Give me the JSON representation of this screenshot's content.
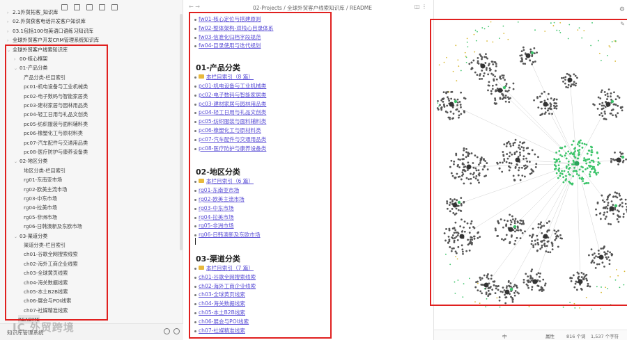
{
  "sidebar": {
    "top_rows": [
      {
        "label": "2.1外贸拓客_知识库",
        "indent": 0,
        "folder": true
      },
      {
        "label": "02.外贸获客电话开发客户知识库",
        "indent": 0,
        "folder": true
      },
      {
        "label": "03.1包括100句英语口语练习知识库",
        "indent": 0,
        "folder": true
      },
      {
        "label": "全球外贸客户开发CRM管理系统知识库",
        "indent": 0,
        "folder": true
      }
    ],
    "root": {
      "label": "全球外贸客户线索知识库"
    },
    "groups": [
      {
        "label": "00-核心框架",
        "children": []
      },
      {
        "label": "01-产品分类",
        "children": [
          "产品分类-栏目索引",
          "pc01-机电设备与工业机械类",
          "pc02-电子数码与智能家居类",
          "pc03-建材家居与园林用品类",
          "pc04-轻工日用与礼品文创类",
          "pc05-纺织服装与面料辅料类",
          "pc06-橡塑化工与原材料类",
          "pc07-汽车配件与交通用品类",
          "pc08-医疗防护与康养设备类"
        ]
      },
      {
        "label": "02-地区分类",
        "children": [
          "地区分类-栏目索引",
          "rg01-东南亚市场",
          "rg02-欧美主流市场",
          "rg03-中东市场",
          "rg04-拉美市场",
          "rg05-非洲市场",
          "rg06-日韩澳新及东欧市场"
        ]
      },
      {
        "label": "03-渠道分类",
        "children": [
          "渠道分类-栏目索引",
          "ch01-谷歌全网搜索线索",
          "ch02-海外工商企业线索",
          "ch03-全球黄页线索",
          "ch04-海关数据线索",
          "ch05-本土B2B线索",
          "ch06-展会与POI线索",
          "ch07-社媒精准线索"
        ]
      }
    ],
    "readme": "README",
    "partial_row": "... 网站 ... 家具家居 ... 小图释",
    "bottom_label": "知识库管理系统",
    "watermark": "IC 外贸跨境"
  },
  "editor": {
    "breadcrumb": "02-Projects / 全球外贸客户线索知识库 / README",
    "nav": "← →",
    "actions": "◫ ⋮",
    "top_links": [
      "fw01-核心定位与搭建原则",
      "fw02-整体架构-双栈心目录体系",
      "fw03-信准化归档字段规范",
      "fw04-目录使用与迭代规划"
    ],
    "sections": [
      {
        "title": "01-产品分类",
        "index": "本栏目索引（8 篇）",
        "links": [
          "pc01-机电设备与工业机械类",
          "pc02-电子数码与智能家居类",
          "pc03-建材家居与园林用品类",
          "pc04-轻工日用与礼品文创类",
          "pc05-纺织服装与面料辅料类",
          "pc06-橡塑化工与原材料类",
          "pc07-汽车配件与交通用品类",
          "pc08-医疗防护与康养设备类"
        ]
      },
      {
        "title": "02-地区分类",
        "index": "本栏目索引（6 篇）",
        "links": [
          "rg01-东南亚市场",
          "rg02-欧美主流市场",
          "rg03-中东市场",
          "rg04-拉美市场",
          "rg05-非洲市场",
          "rg06-日韩澳新及东欧市场"
        ]
      },
      {
        "title": "03-渠道分类",
        "index": "本栏目索引（7 篇）",
        "links": [
          "ch01-谷歌全网搜索线索",
          "ch02-海外工商企业线索",
          "ch03-全球黄页线索",
          "ch04-海关数据线索",
          "ch05-本土B2B线索",
          "ch06-展会与POI线索",
          "ch07-社媒精准线索"
        ]
      }
    ]
  },
  "graph": {
    "gear": "⚙",
    "pin": "✎",
    "colors": {
      "node": "#555555",
      "green": "#3cc46a",
      "yellow": "#d8b72e",
      "line": "#cfcfcf"
    }
  },
  "status": {
    "mode": "中",
    "props": "属性",
    "words": "816 个词",
    "chars": "1,537 个字符"
  }
}
